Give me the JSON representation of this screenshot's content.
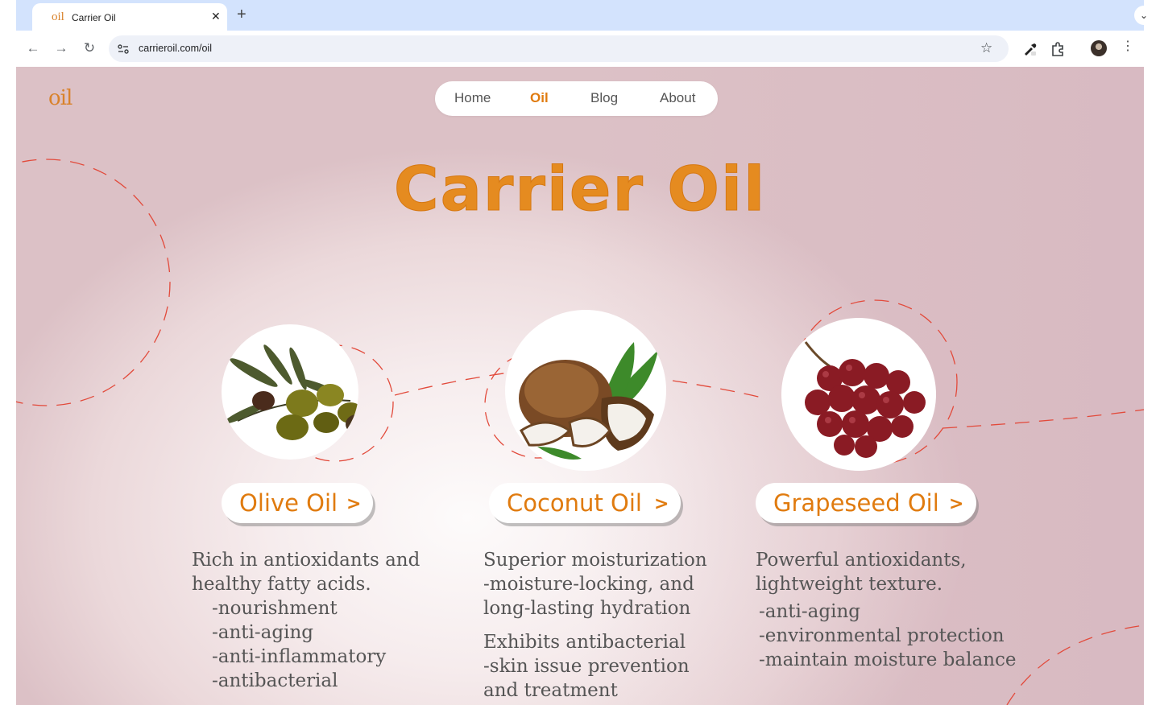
{
  "browser": {
    "tab_logo": "oil",
    "tab_title": "Carrier Oil",
    "tab_close": "✕",
    "new_tab": "+",
    "tab_menu": "⌄",
    "url": "carrieroil.com/oil",
    "back": "←",
    "forward": "→",
    "reload": "↻",
    "star": "☆",
    "kebab": "⋮"
  },
  "site": {
    "brand": "oil",
    "nav": [
      {
        "label": "Home",
        "active": false
      },
      {
        "label": "Oil",
        "active": true
      },
      {
        "label": "Blog",
        "active": false
      },
      {
        "label": "About",
        "active": false
      }
    ],
    "hero_title": "Carrier Oil",
    "accent_color": "#e07b0f",
    "dash_color": "#e24a3b"
  },
  "oils": [
    {
      "name": "Olive Oil",
      "chevron": ">",
      "icon": "olive-branch-image",
      "description": {
        "intro": [
          "Rich in antioxidants and",
          "healthy fatty acids."
        ],
        "points": [
          "-nourishment",
          "-anti-aging",
          "-anti-inflammatory",
          "-antibacterial"
        ]
      }
    },
    {
      "name": "Coconut Oil",
      "chevron": ">",
      "icon": "coconut-image",
      "description": {
        "intro": [
          "Superior moisturization",
          "-moisture-locking, and",
          "long-lasting hydration"
        ],
        "secondary": [
          "Exhibits antibacterial",
          "-skin issue prevention",
          "and treatment"
        ]
      }
    },
    {
      "name": "Grapeseed Oil",
      "chevron": ">",
      "icon": "grape-cluster-image",
      "description": {
        "intro": [
          "Powerful antioxidants,",
          "lightweight texture."
        ],
        "points": [
          "-anti-aging",
          "-environmental protection",
          "-maintain moisture balance"
        ]
      }
    }
  ]
}
